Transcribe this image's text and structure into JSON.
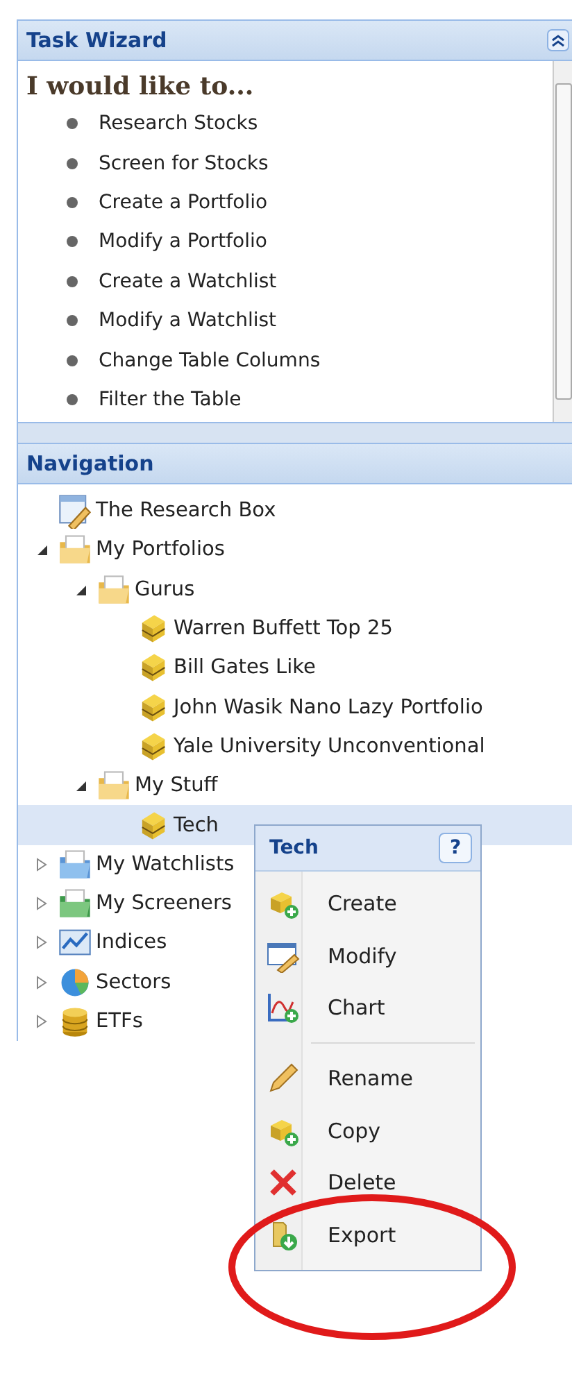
{
  "task_wizard": {
    "title": "Task Wizard",
    "heading": "I would like to...",
    "items": [
      "Research Stocks",
      "Screen for Stocks",
      "Create a Portfolio",
      "Modify a Portfolio",
      "Create a Watchlist",
      "Modify a Watchlist",
      "Change Table Columns",
      "Filter the Table"
    ]
  },
  "navigation": {
    "title": "Navigation",
    "tree": [
      {
        "label": "The Research Box",
        "kind": "research",
        "selected": false
      },
      {
        "label": "My Portfolios",
        "kind": "folder",
        "expanded": true,
        "selected": false,
        "children": [
          {
            "label": "Gurus",
            "kind": "folder",
            "expanded": true,
            "selected": false,
            "children": [
              {
                "label": "Warren Buffett Top 25",
                "kind": "portfolio",
                "selected": false
              },
              {
                "label": "Bill Gates Like",
                "kind": "portfolio",
                "selected": false
              },
              {
                "label": "John Wasik Nano Lazy Portfolio",
                "kind": "portfolio",
                "selected": false
              },
              {
                "label": "Yale University Unconventional",
                "kind": "portfolio",
                "selected": false
              }
            ]
          },
          {
            "label": "My Stuff",
            "kind": "folder",
            "expanded": true,
            "selected": false,
            "children": [
              {
                "label": "Tech",
                "kind": "portfolio",
                "selected": true
              }
            ]
          }
        ]
      },
      {
        "label": "My Watchlists",
        "kind": "watchlists",
        "expanded": false,
        "selected": false
      },
      {
        "label": "My Screeners",
        "kind": "screeners",
        "expanded": false,
        "selected": false
      },
      {
        "label": "Indices",
        "kind": "indices",
        "expanded": false,
        "selected": false
      },
      {
        "label": "Sectors",
        "kind": "sectors",
        "expanded": false,
        "selected": false
      },
      {
        "label": "ETFs",
        "kind": "etfs",
        "expanded": false,
        "selected": false
      }
    ]
  },
  "context_menu": {
    "title": "Tech",
    "help": "?",
    "groups": [
      [
        {
          "label": "Create",
          "kind": "create"
        },
        {
          "label": "Modify",
          "kind": "modify"
        },
        {
          "label": "Chart",
          "kind": "chart"
        }
      ],
      [
        {
          "label": "Rename",
          "kind": "rename"
        },
        {
          "label": "Copy",
          "kind": "copy"
        },
        {
          "label": "Delete",
          "kind": "delete"
        },
        {
          "label": "Export",
          "kind": "export"
        }
      ]
    ]
  }
}
